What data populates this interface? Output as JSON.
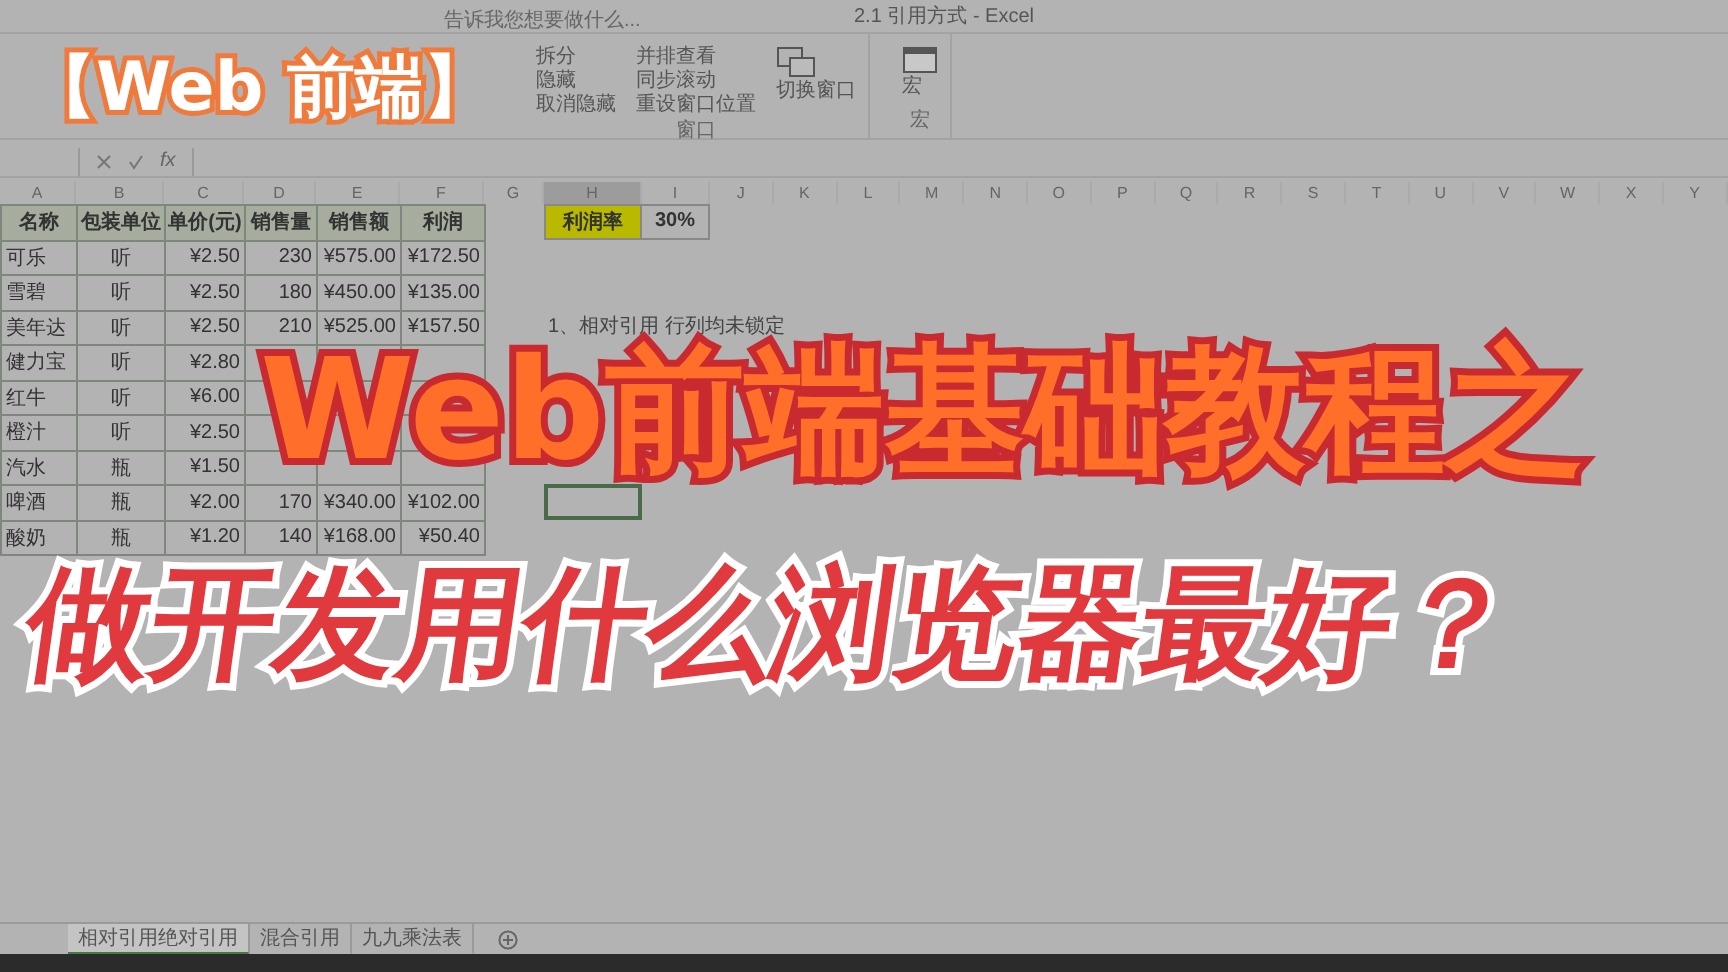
{
  "window": {
    "title": "2.1 引用方式 - Excel"
  },
  "ribbon": {
    "search_hint": "告诉我您想要做什么...",
    "window_items": [
      "拆分",
      "隐藏",
      "取消隐藏"
    ],
    "window_items_2": [
      "并排查看",
      "同步滚动",
      "重设窗口位置"
    ],
    "switch_window": "切换窗口",
    "group_label": "窗口",
    "macro_button": "宏",
    "macro_label": "宏"
  },
  "formula_bar": {
    "function_label": "fx"
  },
  "columns": [
    {
      "label": "A",
      "selected": false
    },
    {
      "label": "B",
      "selected": false
    },
    {
      "label": "C",
      "selected": false
    },
    {
      "label": "D",
      "selected": false
    },
    {
      "label": "E",
      "selected": false
    },
    {
      "label": "F",
      "selected": false
    },
    {
      "label": "G",
      "selected": false
    },
    {
      "label": "H",
      "selected": true
    },
    {
      "label": "I",
      "selected": false
    },
    {
      "label": "J",
      "selected": false
    },
    {
      "label": "K",
      "selected": false
    },
    {
      "label": "L",
      "selected": false
    },
    {
      "label": "M",
      "selected": false
    },
    {
      "label": "N",
      "selected": false
    },
    {
      "label": "O",
      "selected": false
    },
    {
      "label": "P",
      "selected": false
    },
    {
      "label": "Q",
      "selected": false
    },
    {
      "label": "R",
      "selected": false
    },
    {
      "label": "S",
      "selected": false
    },
    {
      "label": "T",
      "selected": false
    },
    {
      "label": "U",
      "selected": false
    },
    {
      "label": "V",
      "selected": false
    },
    {
      "label": "W",
      "selected": false
    },
    {
      "label": "X",
      "selected": false
    },
    {
      "label": "Y",
      "selected": false
    }
  ],
  "table": {
    "header": [
      "名称",
      "包装单位",
      "单价(元)",
      "销售量",
      "销售额",
      "利润"
    ],
    "rows": [
      [
        "可乐",
        "听",
        "¥2.50",
        "230",
        "¥575.00",
        "¥172.50"
      ],
      [
        "雪碧",
        "听",
        "¥2.50",
        "180",
        "¥450.00",
        "¥135.00"
      ],
      [
        "美年达",
        "听",
        "¥2.50",
        "210",
        "¥525.00",
        "¥157.50"
      ],
      [
        "健力宝",
        "听",
        "¥2.80",
        null,
        null,
        null
      ],
      [
        "红牛",
        "听",
        "¥6.00",
        null,
        null,
        null
      ],
      [
        "橙汁",
        "听",
        "¥2.50",
        null,
        null,
        null
      ],
      [
        "汽水",
        "瓶",
        "¥1.50",
        null,
        null,
        null
      ],
      [
        "啤酒",
        "瓶",
        "¥2.00",
        "170",
        "¥340.00",
        "¥102.00"
      ],
      [
        "酸奶",
        "瓶",
        "¥1.20",
        "140",
        "¥168.00",
        "¥50.40"
      ]
    ]
  },
  "rate": {
    "label": "利润率",
    "value": "30%"
  },
  "notes": [
    "1、相对引用 行列均未锁定"
  ],
  "sheet_tabs": [
    {
      "label": "相对引用绝对引用",
      "selected": true
    },
    {
      "label": "混合引用",
      "selected": false
    },
    {
      "label": "九九乘法表",
      "selected": false
    }
  ],
  "overlay": {
    "tag": "【Web 前端】",
    "title": "Web前端基础教程之",
    "subtitle": "做开发用什么浏览器最好？"
  }
}
